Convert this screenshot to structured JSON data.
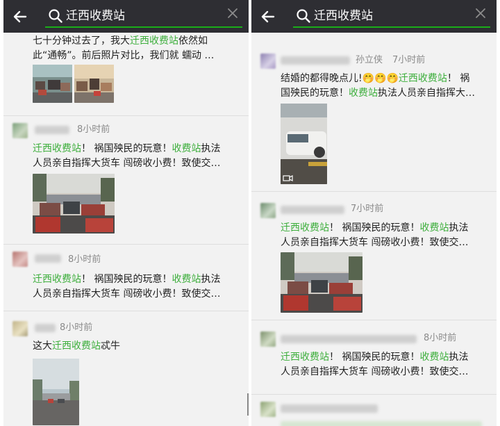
{
  "search": {
    "query": "迁西收费站"
  },
  "left": {
    "posts": [
      {
        "lines": [
          [
            {
              "t": "七十分钟过去了，我大"
            },
            {
              "t": "迁西收费站",
              "hl": true
            },
            {
              "t": "依然如"
            }
          ],
          [
            {
              "t": "此“通畅”。前后照片对比，我们就 蠕动 …"
            }
          ]
        ]
      },
      {
        "time": "8小时前",
        "lines": [
          [
            {
              "t": "迁西收费站",
              "hl": true
            },
            {
              "t": "！ 祸国殃民的玩意！"
            },
            {
              "t": "收费站",
              "hl": true
            },
            {
              "t": "执法"
            }
          ],
          [
            {
              "t": "人员亲自指挥大货车 闯磅收小费！致使交…"
            }
          ]
        ]
      },
      {
        "time": "8小时前",
        "lines": [
          [
            {
              "t": "迁西收费站",
              "hl": true
            },
            {
              "t": "！ 祸国殃民的玩意！"
            },
            {
              "t": "收费站",
              "hl": true
            },
            {
              "t": "执法"
            }
          ],
          [
            {
              "t": "人员亲自指挥大货车 闯磅收小费！致使交…"
            }
          ]
        ]
      },
      {
        "time": "8小时前",
        "lines": [
          [
            {
              "t": "这大"
            },
            {
              "t": "迁西收费站",
              "hl": true
            },
            {
              "t": "忒牛"
            }
          ]
        ]
      }
    ]
  },
  "right": {
    "posts": [
      {
        "name": "孙立侠",
        "time": "7小时前",
        "lines": [
          [
            {
              "t": "结婚的都得晚点儿!"
            },
            {
              "t": "🤭🤭🤭",
              "emoji": true
            },
            {
              "t": "迁西收费站",
              "hl": true
            },
            {
              "t": "！ 祸"
            }
          ],
          [
            {
              "t": "国殃民的玩意！"
            },
            {
              "t": "收费站",
              "hl": true
            },
            {
              "t": "执法人员亲自指挥大…"
            }
          ]
        ]
      },
      {
        "time": "7小时前",
        "lines": [
          [
            {
              "t": "迁西收费站",
              "hl": true
            },
            {
              "t": "！ 祸国殃民的玩意！"
            },
            {
              "t": "收费站",
              "hl": true
            },
            {
              "t": "执法"
            }
          ],
          [
            {
              "t": "人员亲自指挥大货车 闯磅收小费！致使交…"
            }
          ]
        ]
      },
      {
        "time": "8小时前",
        "lines": [
          [
            {
              "t": "迁西收费站",
              "hl": true
            },
            {
              "t": "！ 祸国殃民的玩意！"
            },
            {
              "t": "收费站",
              "hl": true
            },
            {
              "t": "执法"
            }
          ],
          [
            {
              "t": "人员亲自指挥大货车 闯磅收小费！致使交…"
            }
          ]
        ]
      }
    ]
  },
  "colors": {
    "topbar": "#2e2e33",
    "accent": "#1aad19",
    "highlight": "#3cae3b",
    "timestamp": "#8a8a8a"
  },
  "icons": {
    "back": "arrow-left-icon",
    "search": "magnifier-icon",
    "clear": "close-icon",
    "video": "video-camera-icon"
  }
}
